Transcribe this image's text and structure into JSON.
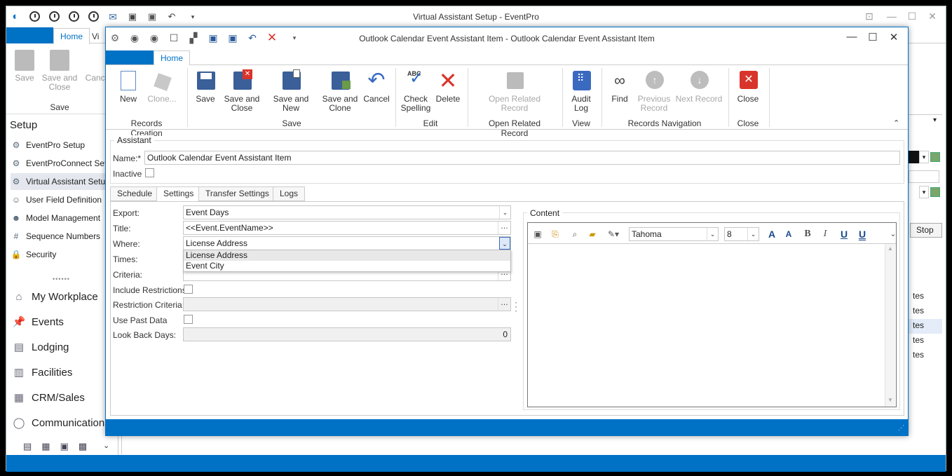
{
  "outer_window": {
    "title": "Virtual Assistant Setup - EventPro",
    "tabs": [
      "Home",
      "Vi"
    ],
    "ribbon": {
      "save": "Save",
      "save_and_close": "Save and Close",
      "cancel": "Cance",
      "group": "Save"
    },
    "setup_title": "Setup",
    "setup_items": [
      "EventPro Setup",
      "EventProConnect Setup",
      "Virtual Assistant Setup",
      "User Field Definition",
      "Model Management",
      "Sequence Numbers",
      "Security"
    ],
    "nav_items": [
      "My Workplace",
      "Events",
      "Lodging",
      "Facilities",
      "CRM/Sales",
      "Communications"
    ],
    "right_strip": {
      "stop": "Stop",
      "rows": [
        "tes",
        "tes",
        "tes",
        "tes",
        "tes"
      ]
    }
  },
  "inner_window": {
    "title": "Outlook Calendar Event Assistant Item - Outlook Calendar Event Assistant Item",
    "tab": "Home",
    "ribbon": {
      "new": "New",
      "clone": "Clone...",
      "save": "Save",
      "save_and_close": "Save and Close",
      "save_and_new": "Save and New",
      "save_and_clone": "Save and Clone",
      "cancel": "Cancel",
      "check_spelling": "Check Spelling",
      "delete": "Delete",
      "open_related_record": "Open Related Record",
      "audit_log": "Audit Log",
      "find": "Find",
      "previous_record": "Previous Record",
      "next_record": "Next Record",
      "close": "Close",
      "groups": {
        "records_creation": "Records Creation",
        "save": "Save",
        "edit": "Edit",
        "open_related_record": "Open Related Record",
        "view": "View",
        "records_navigation": "Records Navigation",
        "close": "Close"
      }
    },
    "assistant": {
      "group_label": "Assistant",
      "name_label": "Name:*",
      "name_value": "Outlook Calendar Event Assistant Item",
      "inactive_label": "Inactive"
    },
    "tabs": [
      "Schedule",
      "Settings",
      "Transfer Settings",
      "Logs"
    ],
    "settings": {
      "export_label": "Export:",
      "export_value": "Event Days",
      "title_label": "Title:",
      "title_value": "<<Event.EventName>>",
      "where_label": "Where:",
      "where_value": "License Address",
      "where_options": [
        "License Address",
        "Event City"
      ],
      "times_label": "Times:",
      "criteria_label": "Criteria:",
      "include_restrictions_label": "Include Restrictions",
      "restriction_criteria_label": "Restriction Criteria:",
      "use_past_data_label": "Use Past Data",
      "look_back_days_label": "Look Back Days:",
      "look_back_days_value": "0"
    },
    "content": {
      "label": "Content",
      "font": "Tahoma",
      "size": "8",
      "toolbar": [
        "save-icon",
        "import-icon",
        "find-icon",
        "open-icon",
        "format-icon",
        "grow-font-icon",
        "shrink-font-icon",
        "bold-icon",
        "italic-icon",
        "underline-icon",
        "double-underline-icon"
      ]
    }
  },
  "colors": {
    "accent": "#0072c6",
    "title_bg": "#ffffff",
    "disabled_text": "#a8a8a8",
    "close_red": "#d9342b"
  }
}
